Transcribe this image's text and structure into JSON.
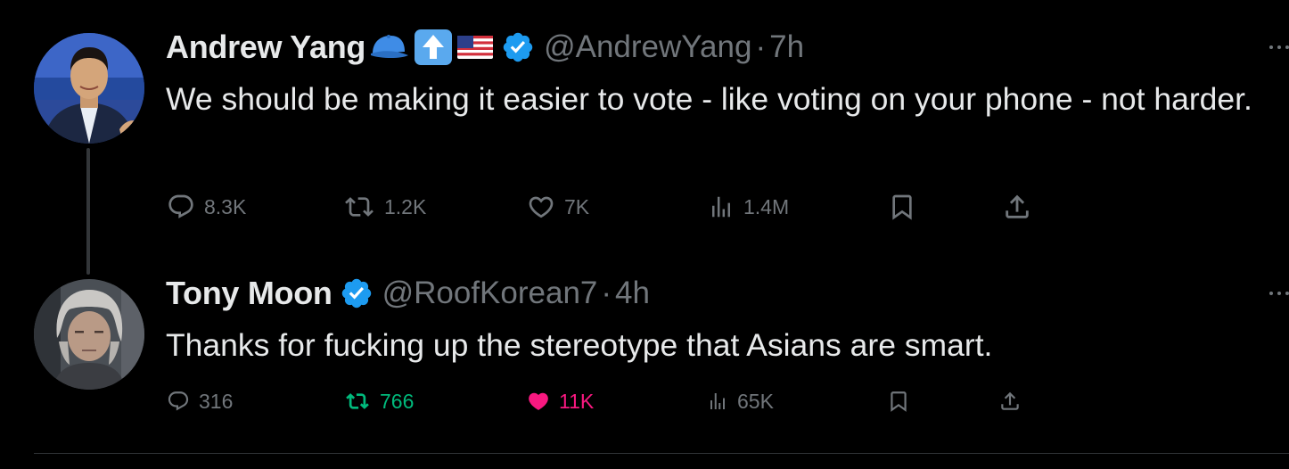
{
  "colors": {
    "background": "#000000",
    "text_primary": "#e7e9ea",
    "text_secondary": "#71767b",
    "verified_blue": "#1d9bf0",
    "retweet_green": "#00ba7c",
    "like_pink": "#f91880"
  },
  "tweets": [
    {
      "author": {
        "name": "Andrew Yang",
        "emojis": [
          "blue-cap-emoji",
          "up-arrow-emoji",
          "us-flag-emoji"
        ],
        "verified": true,
        "handle": "@AndrewYang",
        "separator": "·",
        "time": "7h"
      },
      "text": "We should be making it easier to vote - like voting on your phone - not harder.",
      "stats": {
        "replies": "8.3K",
        "retweets": "1.2K",
        "likes": "7K",
        "views": "1.4M"
      },
      "state": {
        "retweeted": false,
        "liked": false
      }
    },
    {
      "author": {
        "name": "Tony Moon",
        "emojis": [],
        "verified": true,
        "handle": "@RoofKorean7",
        "separator": "·",
        "time": "4h"
      },
      "text": "Thanks for fucking up the stereotype that Asians are smart.",
      "stats": {
        "replies": "316",
        "retweets": "766",
        "likes": "11K",
        "views": "65K"
      },
      "state": {
        "retweeted": true,
        "liked": true
      }
    }
  ]
}
